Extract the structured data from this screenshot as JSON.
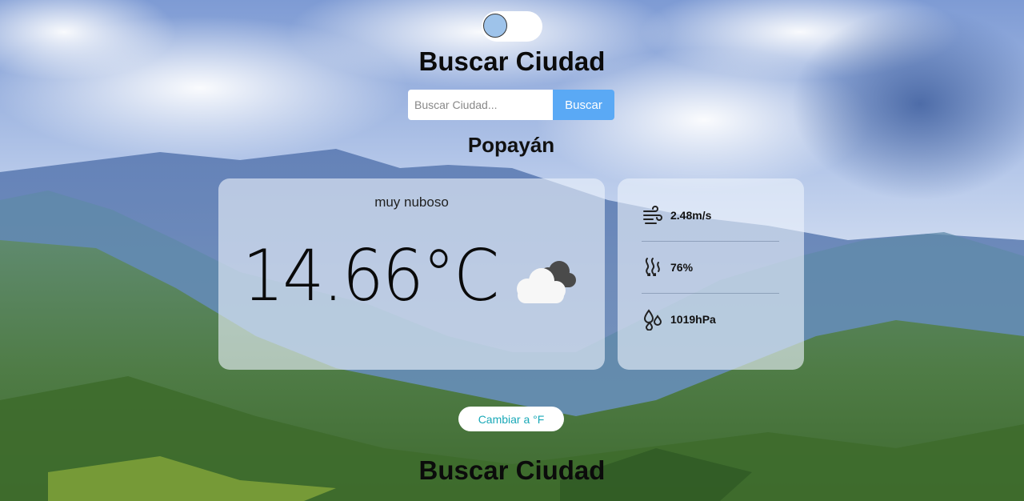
{
  "header": {
    "title": "Buscar Ciudad",
    "theme_toggle_icon": "circle-knob-icon"
  },
  "search": {
    "placeholder": "Buscar Ciudad...",
    "value": "",
    "button_label": "Buscar"
  },
  "weather": {
    "city": "Popayán",
    "description": "muy nuboso",
    "temperature": "14.66°C",
    "condition_icon": "cloud-icon",
    "wind": "2.48m/s",
    "humidity": "76%",
    "pressure": "1019hPa"
  },
  "footer": {
    "unit_button": "Cambiar a °F",
    "title": "Buscar Ciudad"
  },
  "colors": {
    "accent_button": "#5aa9f5",
    "unit_button_text": "#1aa9b8",
    "toggle_knob": "#9ec3ea"
  }
}
